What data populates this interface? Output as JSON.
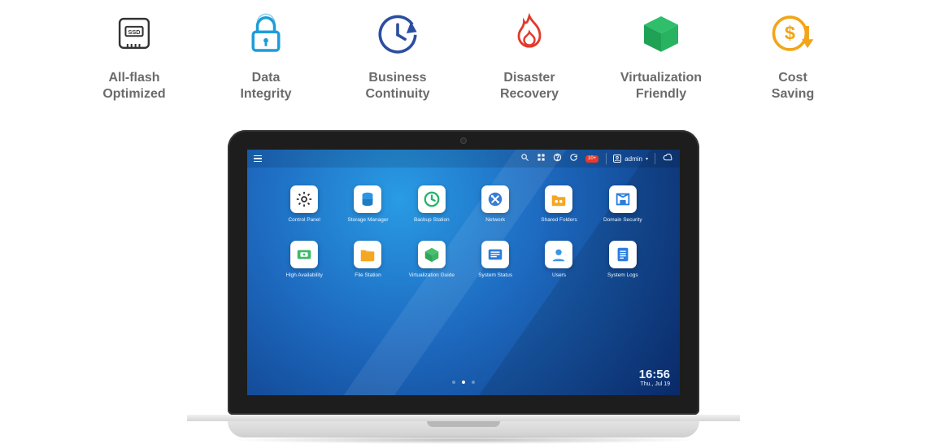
{
  "features": [
    {
      "label": "All-flash\nOptimized",
      "icon": "ssd"
    },
    {
      "label": "Data\nIntegrity",
      "icon": "lock"
    },
    {
      "label": "Business\nContinuity",
      "icon": "clock-arrow"
    },
    {
      "label": "Disaster\nRecovery",
      "icon": "flame"
    },
    {
      "label": "Virtualization\nFriendly",
      "icon": "cube"
    },
    {
      "label": "Cost\nSaving",
      "icon": "dollar-down"
    }
  ],
  "topbar": {
    "notification_badge": "10+",
    "user": "admin"
  },
  "apps": [
    {
      "label": "Control Panel",
      "icon": "gear"
    },
    {
      "label": "Storage Manager",
      "icon": "database"
    },
    {
      "label": "Backup Station",
      "icon": "backup"
    },
    {
      "label": "Network",
      "icon": "network"
    },
    {
      "label": "Shared Folders",
      "icon": "shared-folder"
    },
    {
      "label": "Domain Security",
      "icon": "domain-security"
    },
    {
      "label": "High Availability",
      "icon": "ha"
    },
    {
      "label": "File Station",
      "icon": "file-station"
    },
    {
      "label": "Virtualization Guide",
      "icon": "virt"
    },
    {
      "label": "System Status",
      "icon": "status"
    },
    {
      "label": "Users",
      "icon": "users"
    },
    {
      "label": "System Logs",
      "icon": "logs"
    }
  ],
  "clock": {
    "time": "16:56",
    "date": "Thu., Jul 19"
  },
  "pager": {
    "total": 3,
    "active": 1
  }
}
